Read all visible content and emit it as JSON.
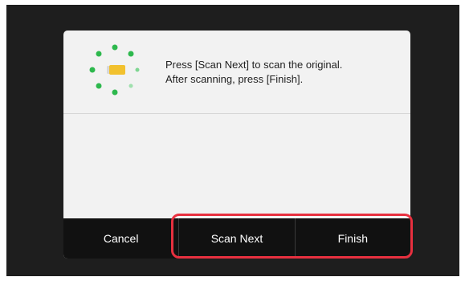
{
  "dialog": {
    "message_line1": "Press [Scan Next] to scan the original.",
    "message_line2": "After scanning, press [Finish].",
    "icon": "scanning-progress-icon"
  },
  "buttons": {
    "cancel": "Cancel",
    "scan_next": "Scan Next",
    "finish": "Finish"
  },
  "colors": {
    "screen_bg": "#1e1e1e",
    "dialog_bg": "#f2f2f2",
    "button_bar_bg": "#111111",
    "spinner_dots": "#2db84d",
    "document_icon": "#f2c12e",
    "highlight": "#e8303f"
  }
}
